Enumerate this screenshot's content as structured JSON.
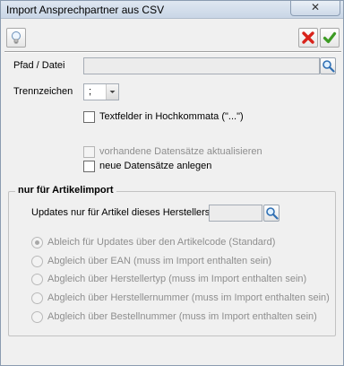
{
  "window": {
    "title": "Import Ansprechpartner aus CSV",
    "close_label": "✕"
  },
  "toolbar": {
    "tip_icon": "lightbulb-icon",
    "cancel_icon": "red-x-icon",
    "ok_icon": "green-check-icon"
  },
  "form": {
    "path_label": "Pfad / Datei",
    "path_value": "",
    "separator_label": "Trennzeichen",
    "separator_value": ";",
    "quoted_label": "Textfelder in Hochkommata (\"...\")",
    "update_label": "vorhandene Datensätze aktualisieren",
    "create_label": "neue Datensätze anlegen"
  },
  "article_import": {
    "title": "nur für Artikelimport",
    "manufacturer_label": "Updates nur für Artikel dieses Herstellers",
    "manufacturer_value": "",
    "options": [
      {
        "label": "Ableich für Updates über den Artikelcode (Standard)",
        "selected": true
      },
      {
        "label": "Abgleich über EAN (muss im Import enthalten sein)",
        "selected": false
      },
      {
        "label": "Abgleich über Herstellertyp (muss im Import enthalten sein)",
        "selected": false
      },
      {
        "label": "Abgleich über Herstellernummer (muss im Import enthalten sein)",
        "selected": false
      },
      {
        "label": "Abgleich über Bestellnummer (muss im Import enthalten sein)",
        "selected": false
      }
    ]
  }
}
